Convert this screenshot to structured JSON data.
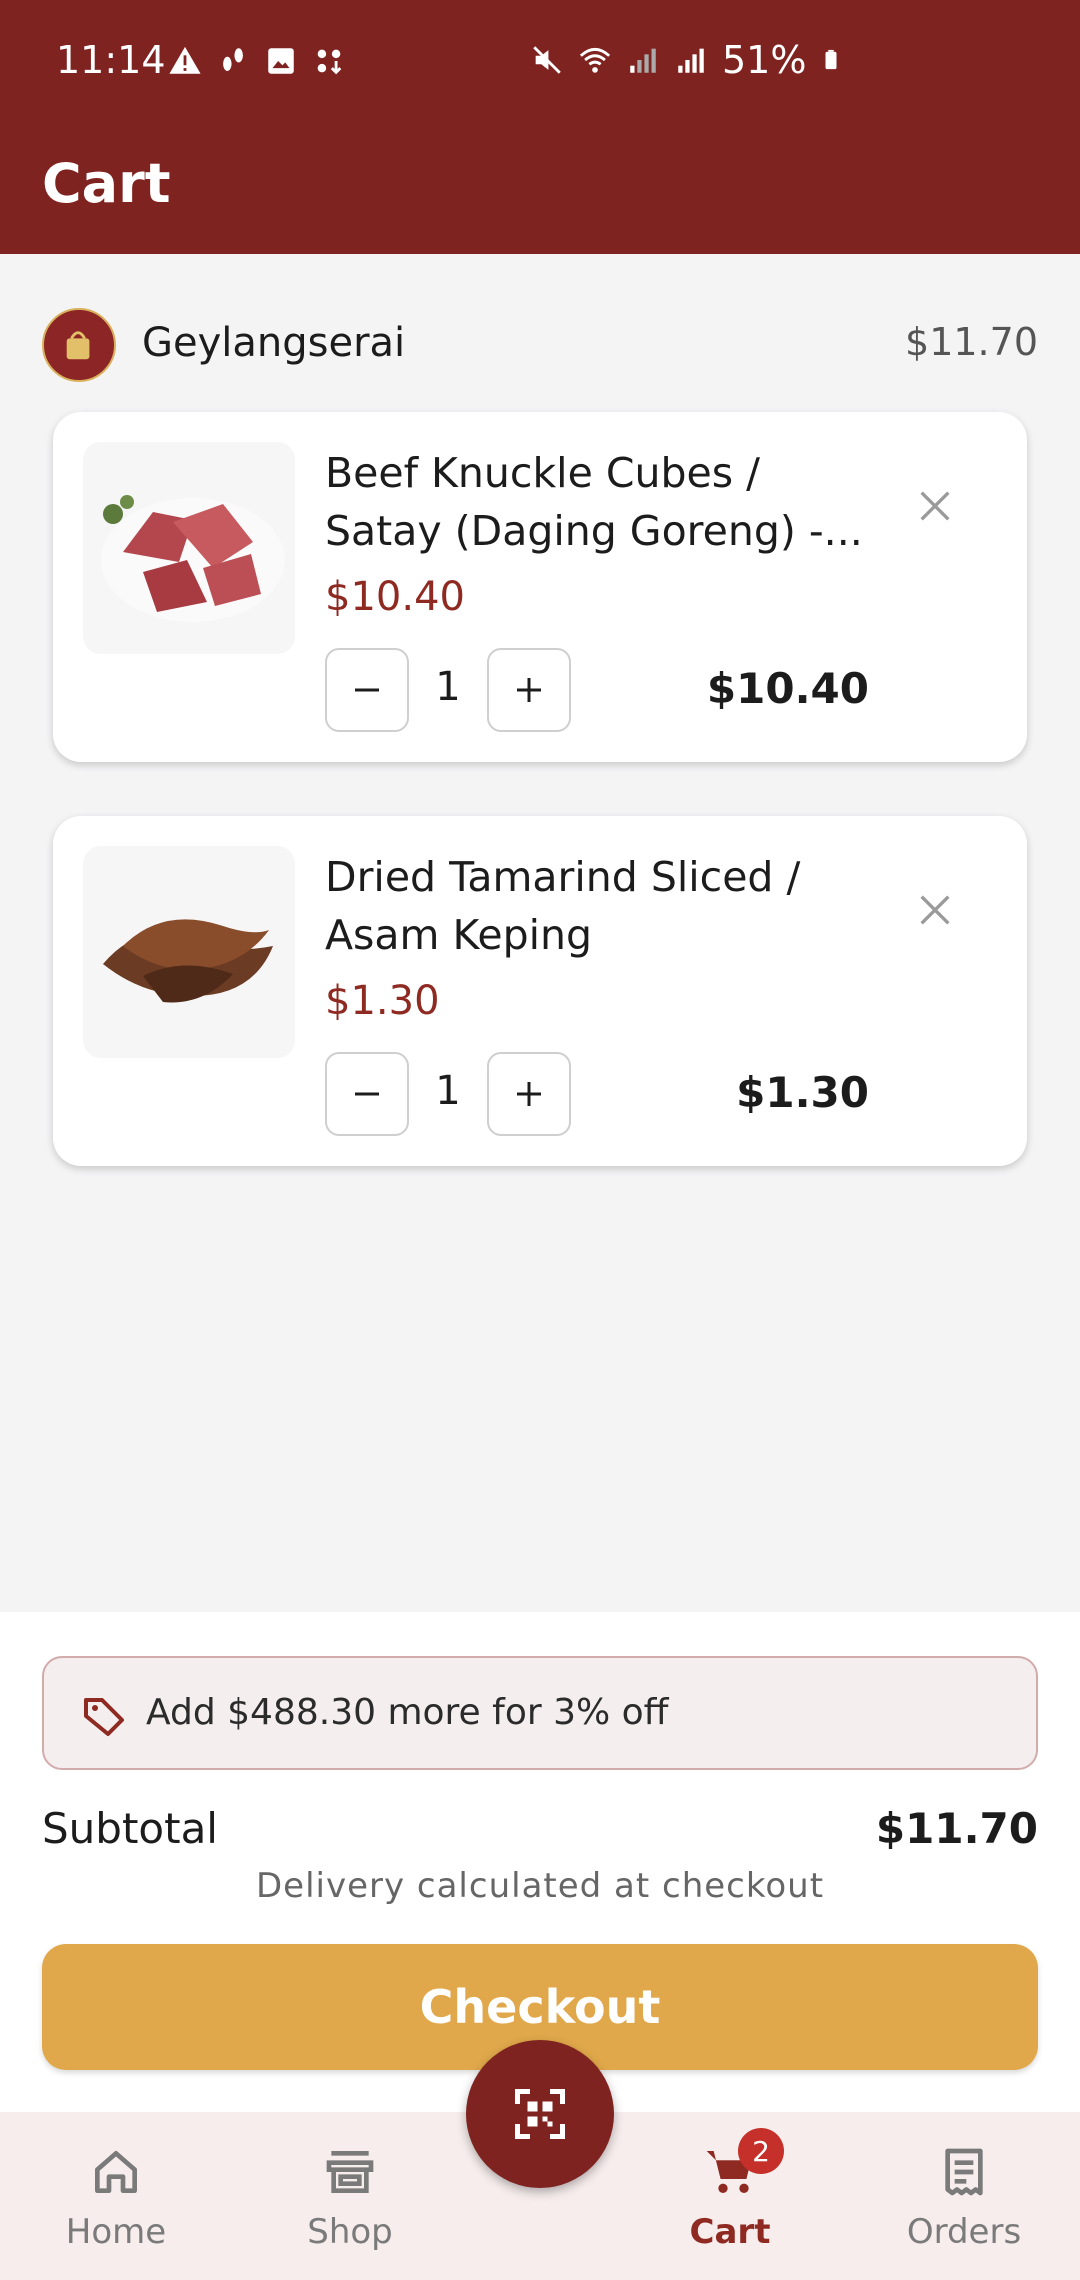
{
  "status_bar": {
    "time": "11:14",
    "battery": "51%"
  },
  "header": {
    "title": "Cart"
  },
  "store": {
    "name": "Geylangserai",
    "total": "$11.70",
    "logo_icon": "store-logo"
  },
  "items": [
    {
      "name": "Beef Knuckle Cubes / Satay (Daging Goreng) -...",
      "unit_price": "$10.40",
      "quantity": "1",
      "line_total": "$10.40"
    },
    {
      "name": "Dried Tamarind Sliced / Asam Keping",
      "unit_price": "$1.30",
      "quantity": "1",
      "line_total": "$1.30"
    }
  ],
  "summary": {
    "discount_message": "Add $488.30 more for 3% off",
    "subtotal_label": "Subtotal",
    "subtotal_value": "$11.70",
    "delivery_note": "Delivery calculated at checkout",
    "checkout_label": "Checkout"
  },
  "nav": {
    "home": "Home",
    "shop": "Shop",
    "cart": "Cart",
    "cart_badge": "2",
    "orders": "Orders"
  },
  "colors": {
    "brand": "#7f2320",
    "price": "#8e2a22",
    "checkout": "#e0a84a",
    "nav_bg": "#f7eded"
  }
}
